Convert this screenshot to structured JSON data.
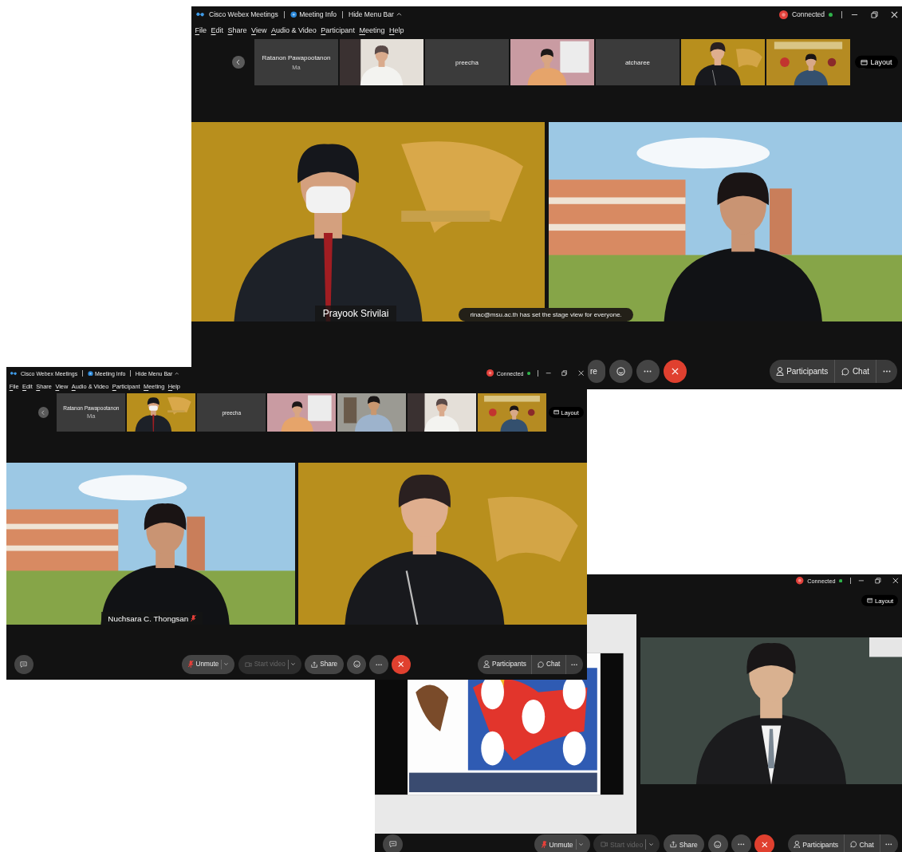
{
  "windows": [
    {
      "title_bar": {
        "app_name": "Cisco Webex Meetings",
        "meeting_info": "Meeting Info",
        "hide_menu_bar": "Hide Menu Bar",
        "status": "Connected"
      },
      "menu": [
        "File",
        "Edit",
        "Share",
        "View",
        "Audio & Video",
        "Participant",
        "Meeting",
        "Help"
      ],
      "thumbnails": [
        {
          "kind": "name",
          "name": "Ratanon Pawapootanon",
          "sub": "Ma"
        },
        {
          "kind": "video"
        },
        {
          "kind": "name",
          "name": "preecha"
        },
        {
          "kind": "video"
        },
        {
          "kind": "name",
          "name": "atcharee"
        },
        {
          "kind": "video"
        },
        {
          "kind": "video"
        }
      ],
      "layout_button": "Layout",
      "stage": [
        {
          "kind": "camera",
          "name_label": "Prayook Srivilai"
        },
        {
          "kind": "camera"
        }
      ],
      "toast": "rinac@msu.ac.th has set the stage view for everyone.",
      "controls": [
        {
          "kind": "share",
          "label": "re"
        },
        {
          "kind": "reaction"
        },
        {
          "kind": "more"
        },
        {
          "kind": "end"
        },
        {
          "kind": "participants",
          "label": "Participants"
        },
        {
          "kind": "chat",
          "label": "Chat"
        },
        {
          "kind": "more"
        }
      ]
    },
    {
      "title_bar": {
        "app_name": "Cisco Webex Meetings",
        "meeting_info": "Meeting Info",
        "hide_menu_bar": "Hide Menu Bar",
        "status": "Connected"
      },
      "menu": [
        "File",
        "Edit",
        "Share",
        "View",
        "Audio & Video",
        "Participant",
        "Meeting",
        "Help"
      ],
      "thumbnails": [
        {
          "kind": "name",
          "name": "Ratanon Pawapootanon",
          "sub": "Ma"
        },
        {
          "kind": "video"
        },
        {
          "kind": "name",
          "name": "preecha"
        },
        {
          "kind": "video"
        },
        {
          "kind": "video"
        },
        {
          "kind": "video"
        },
        {
          "kind": "video"
        }
      ],
      "layout_button": "Layout",
      "stage": [
        {
          "kind": "camera",
          "name_label": "Nuchsara C. Thongsan",
          "muted": true
        },
        {
          "kind": "camera"
        }
      ],
      "controls": [
        {
          "kind": "captions"
        },
        {
          "kind": "unmute",
          "label": "Unmute"
        },
        {
          "kind": "video",
          "label": "Start video",
          "disabled": true
        },
        {
          "kind": "share",
          "label": "Share"
        },
        {
          "kind": "reaction"
        },
        {
          "kind": "more"
        },
        {
          "kind": "end"
        },
        {
          "kind": "participants",
          "label": "Participants"
        },
        {
          "kind": "chat",
          "label": "Chat"
        },
        {
          "kind": "more"
        }
      ]
    },
    {
      "title_bar": {
        "status": "Connected"
      },
      "layout_button": "Layout",
      "stage": [
        {
          "kind": "shared_screen"
        },
        {
          "kind": "camera"
        }
      ],
      "controls": [
        {
          "kind": "captions"
        },
        {
          "kind": "unmute",
          "label": "Unmute"
        },
        {
          "kind": "video",
          "label": "Start video",
          "disabled": true
        },
        {
          "kind": "share",
          "label": "Share"
        },
        {
          "kind": "reaction"
        },
        {
          "kind": "more"
        },
        {
          "kind": "end"
        },
        {
          "kind": "participants",
          "label": "Participants"
        },
        {
          "kind": "chat",
          "label": "Chat"
        },
        {
          "kind": "more"
        }
      ]
    }
  ]
}
